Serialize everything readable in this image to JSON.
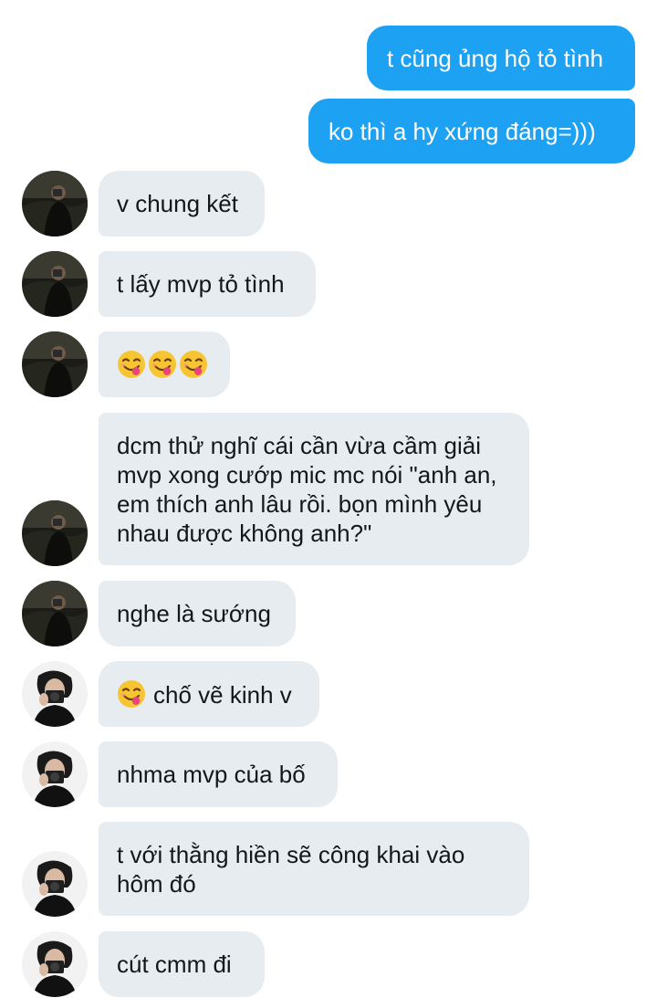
{
  "messages": [
    {
      "side": "out",
      "text": "t cũng ủng hộ tỏ tình"
    },
    {
      "side": "out",
      "text": "ko thì a hy xứng đáng=)))"
    },
    {
      "side": "in",
      "sender": "contact-a",
      "text": "v chung kết"
    },
    {
      "side": "in",
      "sender": "contact-a",
      "text": "t lấy mvp tỏ tình"
    },
    {
      "side": "in",
      "sender": "contact-a",
      "emoji": [
        "smiling-face-savoring-food",
        "smiling-face-savoring-food",
        "smiling-face-savoring-food"
      ],
      "text": ""
    },
    {
      "side": "in",
      "sender": "contact-a",
      "text": "dcm thử nghĩ cái cần vừa cầm giải mvp xong cướp mic mc nói \"anh an, em thích anh lâu rồi. bọn mình yêu nhau được không anh?\""
    },
    {
      "side": "in",
      "sender": "contact-a",
      "text": "nghe là sướng"
    },
    {
      "side": "in",
      "sender": "contact-b",
      "emoji": [
        "smiling-face-savoring-food"
      ],
      "text": "chố vẽ kinh v"
    },
    {
      "side": "in",
      "sender": "contact-b",
      "text": "nhma mvp của bố"
    },
    {
      "side": "in",
      "sender": "contact-b",
      "text": "t với thằng hiền sẽ công khai vào hôm đó"
    },
    {
      "side": "in",
      "sender": "contact-b",
      "text": "cút cmm đi"
    }
  ],
  "colors": {
    "outgoing_bubble": "#1da1f2",
    "incoming_bubble": "#e6ecf0",
    "incoming_text": "#14171a",
    "outgoing_text": "#ffffff"
  },
  "icons": {
    "avatar_a": "dark-photo-person-avatar-icon",
    "avatar_b": "camera-selfie-avatar-icon",
    "emoji": "smiling-face-savoring-food-icon"
  }
}
